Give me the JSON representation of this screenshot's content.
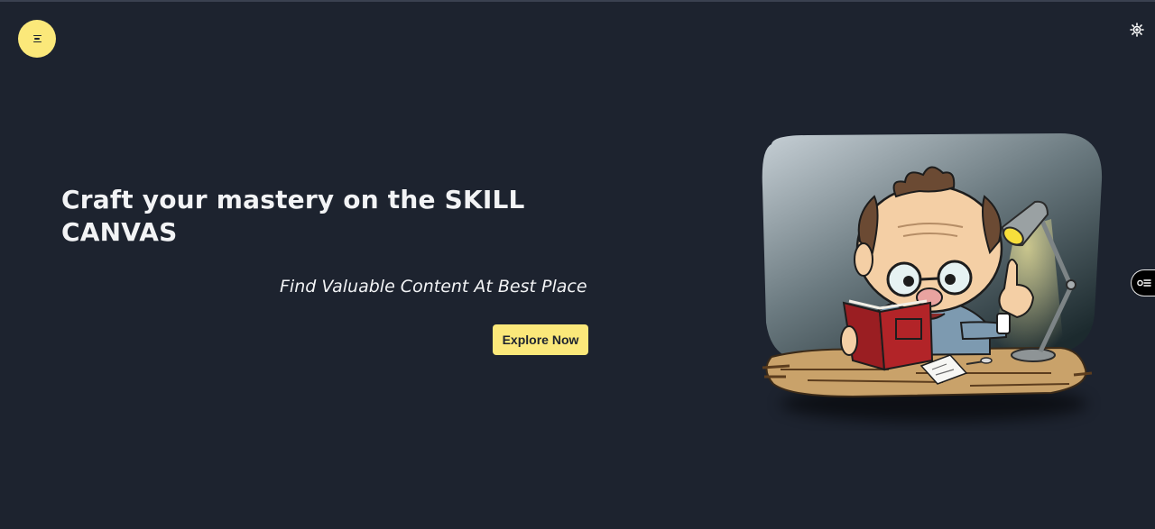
{
  "header": {
    "menu_icon": "menu-icon",
    "theme_icon": "sun-icon"
  },
  "hero": {
    "title": "Craft your mastery on the SKILL CANVAS",
    "subtitle": "Find Valuable Content At Best Place",
    "cta_label": "Explore Now"
  },
  "side_tab": {
    "icon": "toggle-list-icon"
  },
  "colors": {
    "background": "#1d232f",
    "accent": "#fbe87a",
    "text": "#f2f3f5"
  }
}
